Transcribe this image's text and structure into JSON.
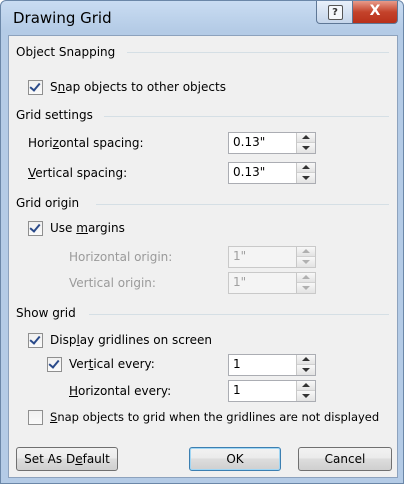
{
  "window": {
    "title": "Drawing Grid",
    "help_glyph": "?",
    "close_glyph": "X"
  },
  "snapping": {
    "header": "Object Snapping",
    "snap_objects": {
      "pre": "S",
      "acc": "n",
      "post": "ap objects to other objects",
      "checked": true
    }
  },
  "grid_settings": {
    "header": "Grid settings",
    "horizontal": {
      "pre": "Hori",
      "acc": "z",
      "post": "ontal spacing:",
      "value": "0.13\""
    },
    "vertical": {
      "pre": "",
      "acc": "V",
      "post": "ertical spacing:",
      "value": "0.13\""
    }
  },
  "grid_origin": {
    "header": "Grid origin",
    "use_margins": {
      "pre": "Use ",
      "acc": "m",
      "post": "argins",
      "checked": true
    },
    "horizontal_origin": {
      "label": "Horizontal origin:",
      "value": "1\""
    },
    "vertical_origin": {
      "label": "Vertical origin:",
      "value": "1\""
    }
  },
  "show_grid": {
    "header": "Show grid",
    "display_gridlines": {
      "pre": "Disp",
      "acc": "l",
      "post": "ay gridlines on screen",
      "checked": true
    },
    "vertical_every": {
      "pre": "Ver",
      "acc": "t",
      "post": "ical every:",
      "checked": true,
      "value": "1"
    },
    "horizontal_every": {
      "pre": "",
      "acc": "H",
      "post": "orizontal every:",
      "value": "1"
    },
    "snap_to_grid": {
      "pre": "",
      "acc": "S",
      "post": "nap objects to grid when the gridlines are not displayed",
      "checked": false
    }
  },
  "buttons": {
    "set_default": {
      "pre": "Set As D",
      "acc": "e",
      "post": "fault"
    },
    "ok": "OK",
    "cancel": "Cancel"
  }
}
